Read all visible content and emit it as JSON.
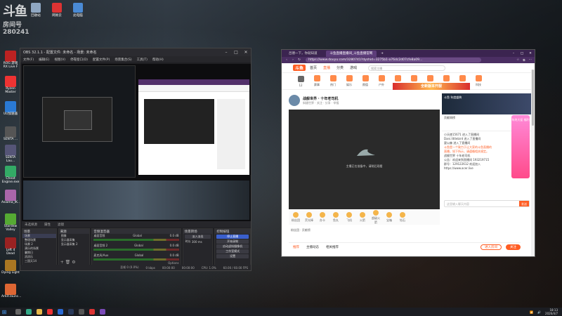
{
  "desktop": {
    "brand": {
      "line1": "斗鱼",
      "line2": "房间号",
      "line3": "280241"
    },
    "top_icons": [
      {
        "label": "回收站"
      },
      {
        "label": "网易云"
      },
      {
        "label": "此电脑"
      }
    ],
    "left_icons": [
      {
        "label": "ROG 游戏\nRX Live F"
      },
      {
        "label": "Ryzen\nMaster"
      },
      {
        "label": "UU加速器"
      },
      {
        "label": "SENTA ..."
      },
      {
        "label": "SENTA Lau..."
      },
      {
        "label": "Cheat\nEngine.exe"
      },
      {
        "label": "Asiama_IK..."
      },
      {
        "label": "Stardew\nValley"
      },
      {
        "label": "Left 4 Dead"
      },
      {
        "label": "Dying Light"
      },
      {
        "label": "Arkit.launc..."
      }
    ]
  },
  "obs": {
    "title": "OBS 32.1.1 - 配置文件: 未命名 - 场景: 未命名",
    "menu": [
      "文件(F)",
      "编辑(E)",
      "视图(V)",
      "停靠窗口(D)",
      "配置文件(P)",
      "场景集合(S)",
      "工具(T)",
      "帮助(H)"
    ],
    "preview_bar": [
      "未选择源",
      "属性",
      "滤镜"
    ],
    "scenes": {
      "header": "场景",
      "items": [
        "场景",
        "整理场景",
        "场景 2",
        "满乐的场景",
        "暑期日",
        "消消乐",
        "三国天14",
        "斜捷世界"
      ]
    },
    "sources": {
      "header": "来源",
      "items": [
        "图像",
        "显示器采集",
        "显示器采集 2"
      ]
    },
    "mixer": {
      "header": "音频混音器",
      "channels": [
        {
          "name": "桌面音频",
          "db": "0.0 dB",
          "tag": "Global"
        },
        {
          "name": "桌面音频 2",
          "db": "0.0 dB",
          "tag": "Global"
        },
        {
          "name": "麦克风/Aux",
          "db": "0.0 dB",
          "tag": "Global"
        }
      ],
      "options": "Options"
    },
    "transitions": {
      "header": "场景转场",
      "type": "淡入淡出",
      "duration_label": "时长",
      "duration": "300 ms"
    },
    "controls": {
      "header": "控制按钮",
      "buttons": [
        "停止直播",
        "开始录制",
        "启动虚拟摄像机",
        "工作室模式",
        "设置"
      ]
    },
    "status": {
      "frames": "丢帧 0 (0.0%)",
      "bitrate": "0 kbps",
      "live": "00:00:00",
      "rec": "00:00:00",
      "cpu": "CPU: 1.0%",
      "fps": "60.00 / 60.00 FPS"
    }
  },
  "browser": {
    "tabs": [
      {
        "label": "吕德一下，你就知道"
      },
      {
        "label": "斗鱼直播直播间_斗鱼直播官网"
      }
    ],
    "url": "https://www.douyu.com/3280741?dyshid=3275b1-a76dc2d07cfe8a09...",
    "site": {
      "logo": "斗鱼",
      "nav": [
        "首页",
        "直播",
        "分类",
        "游戏"
      ],
      "active_nav": "直播",
      "search_placeholder": "搜索主播"
    },
    "categories": [
      "12",
      "赛事",
      "热门",
      "娱乐",
      "颜值",
      "户外",
      "影视",
      "音乐",
      "星秀",
      "二次元",
      "热舞",
      "科技"
    ],
    "banner": "全新版本开服",
    "room": {
      "title": "战舰世界 · 十年老司机",
      "tag": "斜捷世界",
      "sub": "关注 · 分享 · 举报"
    },
    "player_msg": "主播正在准备中，请稍后观看",
    "gifts": [
      "粉丝团",
      "荧光棒",
      "办卡",
      "鱼丸",
      "飞机",
      "火箭",
      "超级火箭",
      "宝箱",
      "钻石"
    ],
    "fan_bar": "粉丝团 · 贡献榜",
    "bottom_tabs": [
      "推荐",
      "主播动态",
      "相关推荐"
    ],
    "active_tab": "推荐",
    "bottom_buttons": [
      "进入房间",
      "关注"
    ],
    "side": {
      "ad_title": "斗鱼 年度盛典",
      "rank_title": "贡献周榜",
      "chat": [
        "小天使15671 进入了直播间",
        "Dani.littlebird 进入了直播间",
        "夏以森 进入了直播间",
        "斗鱼是一个致力于让大家的斗鱼直播的",
        "直播，如下所示，请遵循相关规定。",
        "战舰世界 十年老司机",
        "公告：欢迎来到直播间 193219715",
        "群号：129122612 欢迎加入",
        "https://www.acer.live"
      ],
      "input_placeholder": "这里输入聊天内容",
      "send": "发送"
    },
    "promo": "年终大促 福利"
  },
  "taskbar": {
    "time": "18:13",
    "date": "2026/4/7"
  },
  "colors": {
    "accent": "#ff5d23",
    "obs_active": "#3a5fcd",
    "browser_frame": "#3b2450"
  }
}
